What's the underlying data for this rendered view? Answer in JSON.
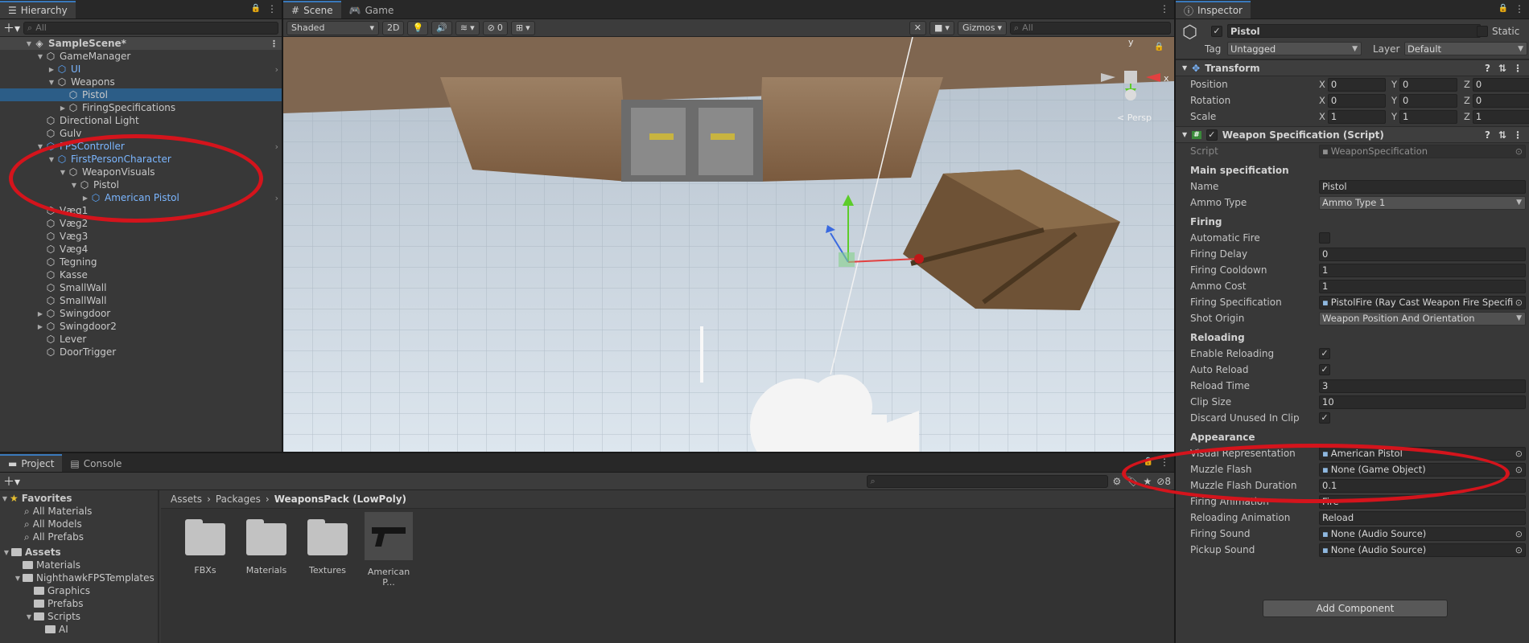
{
  "hierarchy": {
    "tab": "Hierarchy",
    "search_placeholder": "All",
    "scene": "SampleScene*",
    "items": [
      {
        "label": "GameManager",
        "depth": 1,
        "arrow": "down",
        "blue": false
      },
      {
        "label": "UI",
        "depth": 2,
        "arrow": "right",
        "blue": true,
        "more": true
      },
      {
        "label": "Weapons",
        "depth": 2,
        "arrow": "down",
        "blue": false
      },
      {
        "label": "Pistol",
        "depth": 3,
        "arrow": "",
        "blue": false,
        "selected": true
      },
      {
        "label": "FiringSpecifications",
        "depth": 3,
        "arrow": "right",
        "blue": false
      },
      {
        "label": "Directional Light",
        "depth": 1,
        "arrow": "",
        "blue": false
      },
      {
        "label": "Gulv",
        "depth": 1,
        "arrow": "",
        "blue": false
      },
      {
        "label": "FPSController",
        "depth": 1,
        "arrow": "down",
        "blue": true,
        "more": true
      },
      {
        "label": "FirstPersonCharacter",
        "depth": 2,
        "arrow": "down",
        "blue": true
      },
      {
        "label": "WeaponVisuals",
        "depth": 3,
        "arrow": "down",
        "blue": false
      },
      {
        "label": "Pistol",
        "depth": 4,
        "arrow": "down",
        "blue": false
      },
      {
        "label": "American Pistol",
        "depth": 5,
        "arrow": "right",
        "blue": true,
        "more": true
      },
      {
        "label": "Væg1",
        "depth": 1,
        "arrow": "",
        "blue": false
      },
      {
        "label": "Væg2",
        "depth": 1,
        "arrow": "",
        "blue": false
      },
      {
        "label": "Væg3",
        "depth": 1,
        "arrow": "",
        "blue": false
      },
      {
        "label": "Væg4",
        "depth": 1,
        "arrow": "",
        "blue": false
      },
      {
        "label": "Tegning",
        "depth": 1,
        "arrow": "",
        "blue": false
      },
      {
        "label": "Kasse",
        "depth": 1,
        "arrow": "",
        "blue": false
      },
      {
        "label": "SmallWall",
        "depth": 1,
        "arrow": "",
        "blue": false
      },
      {
        "label": "SmallWall",
        "depth": 1,
        "arrow": "",
        "blue": false
      },
      {
        "label": "Swingdoor",
        "depth": 1,
        "arrow": "right",
        "blue": false
      },
      {
        "label": "Swingdoor2",
        "depth": 1,
        "arrow": "right",
        "blue": false
      },
      {
        "label": "Lever",
        "depth": 1,
        "arrow": "",
        "blue": false
      },
      {
        "label": "DoorTrigger",
        "depth": 1,
        "arrow": "",
        "blue": false
      }
    ]
  },
  "scene": {
    "tabs": [
      "Scene",
      "Game"
    ],
    "shading": "Shaded",
    "mode2d": "2D",
    "hidden_count": "0",
    "gizmos": "Gizmos",
    "search_placeholder": "All",
    "persp": "< Persp",
    "axes": {
      "y": "y",
      "x": "x"
    }
  },
  "inspector": {
    "tab": "Inspector",
    "object_name": "Pistol",
    "static_label": "Static",
    "tag_label": "Tag",
    "tag": "Untagged",
    "layer_label": "Layer",
    "layer": "Default",
    "transform": {
      "title": "Transform",
      "rows": [
        {
          "label": "Position",
          "x": "0",
          "y": "0",
          "z": "0"
        },
        {
          "label": "Rotation",
          "x": "0",
          "y": "0",
          "z": "0"
        },
        {
          "label": "Scale",
          "x": "1",
          "y": "1",
          "z": "1"
        }
      ]
    },
    "script_component": {
      "title": "Weapon Specification (Script)",
      "script_label": "Script",
      "script_value": "WeaponSpecification"
    },
    "sections": [
      {
        "heading": "Main specification",
        "rows": [
          {
            "label": "Name",
            "type": "text",
            "value": "Pistol"
          },
          {
            "label": "Ammo Type",
            "type": "drop",
            "value": "Ammo Type 1"
          }
        ]
      },
      {
        "heading": "Firing",
        "rows": [
          {
            "label": "Automatic Fire",
            "type": "check",
            "value": ""
          },
          {
            "label": "Firing Delay",
            "type": "text",
            "value": "0"
          },
          {
            "label": "Firing Cooldown",
            "type": "text",
            "value": "1"
          },
          {
            "label": "Ammo Cost",
            "type": "text",
            "value": "1"
          },
          {
            "label": "Firing Specification",
            "type": "ref",
            "value": "PistolFire (Ray Cast Weapon Fire Specifi"
          },
          {
            "label": "Shot Origin",
            "type": "drop",
            "value": "Weapon Position And Orientation"
          }
        ]
      },
      {
        "heading": "Reloading",
        "rows": [
          {
            "label": "Enable Reloading",
            "type": "check",
            "value": "✓"
          },
          {
            "label": "Auto Reload",
            "type": "check",
            "value": "✓"
          },
          {
            "label": "Reload Time",
            "type": "text",
            "value": "3"
          },
          {
            "label": "Clip Size",
            "type": "text",
            "value": "10"
          },
          {
            "label": "Discard Unused In Clip",
            "type": "check",
            "value": "✓"
          }
        ]
      },
      {
        "heading": "Appearance",
        "rows": [
          {
            "label": "Visual Representation",
            "type": "ref",
            "value": "American Pistol"
          },
          {
            "label": "Muzzle Flash",
            "type": "ref",
            "value": "None (Game Object)"
          },
          {
            "label": "Muzzle Flash Duration",
            "type": "text",
            "value": "0.1"
          },
          {
            "label": "Firing Animation",
            "type": "text",
            "value": "Fire"
          },
          {
            "label": "Reloading Animation",
            "type": "text",
            "value": "Reload"
          },
          {
            "label": "Firing Sound",
            "type": "ref",
            "value": "None (Audio Source)"
          },
          {
            "label": "Pickup Sound",
            "type": "ref",
            "value": "None (Audio Source)"
          }
        ]
      }
    ],
    "add_component": "Add Component"
  },
  "project": {
    "tabs": [
      "Project",
      "Console"
    ],
    "hidden_count": "8",
    "breadcrumb": [
      "Assets",
      "Packages",
      "WeaponsPack (LowPoly)"
    ],
    "favorites": {
      "label": "Favorites",
      "items": [
        "All Materials",
        "All Models",
        "All Prefabs"
      ]
    },
    "tree": [
      {
        "label": "Assets",
        "depth": 0,
        "arrow": "down",
        "bold": true
      },
      {
        "label": "Materials",
        "depth": 1,
        "arrow": ""
      },
      {
        "label": "NighthawkFPSTemplates",
        "depth": 1,
        "arrow": "down"
      },
      {
        "label": "Graphics",
        "depth": 2,
        "arrow": ""
      },
      {
        "label": "Prefabs",
        "depth": 2,
        "arrow": ""
      },
      {
        "label": "Scripts",
        "depth": 2,
        "arrow": "down"
      },
      {
        "label": "AI",
        "depth": 3,
        "arrow": ""
      }
    ],
    "assets": [
      "FBXs",
      "Materials",
      "Textures",
      "American P..."
    ]
  },
  "colors": {
    "accent": "#3a79bb",
    "selection": "#2c5d87",
    "annotation": "#d4141c",
    "prefab_blue": "#7bb6ff"
  }
}
